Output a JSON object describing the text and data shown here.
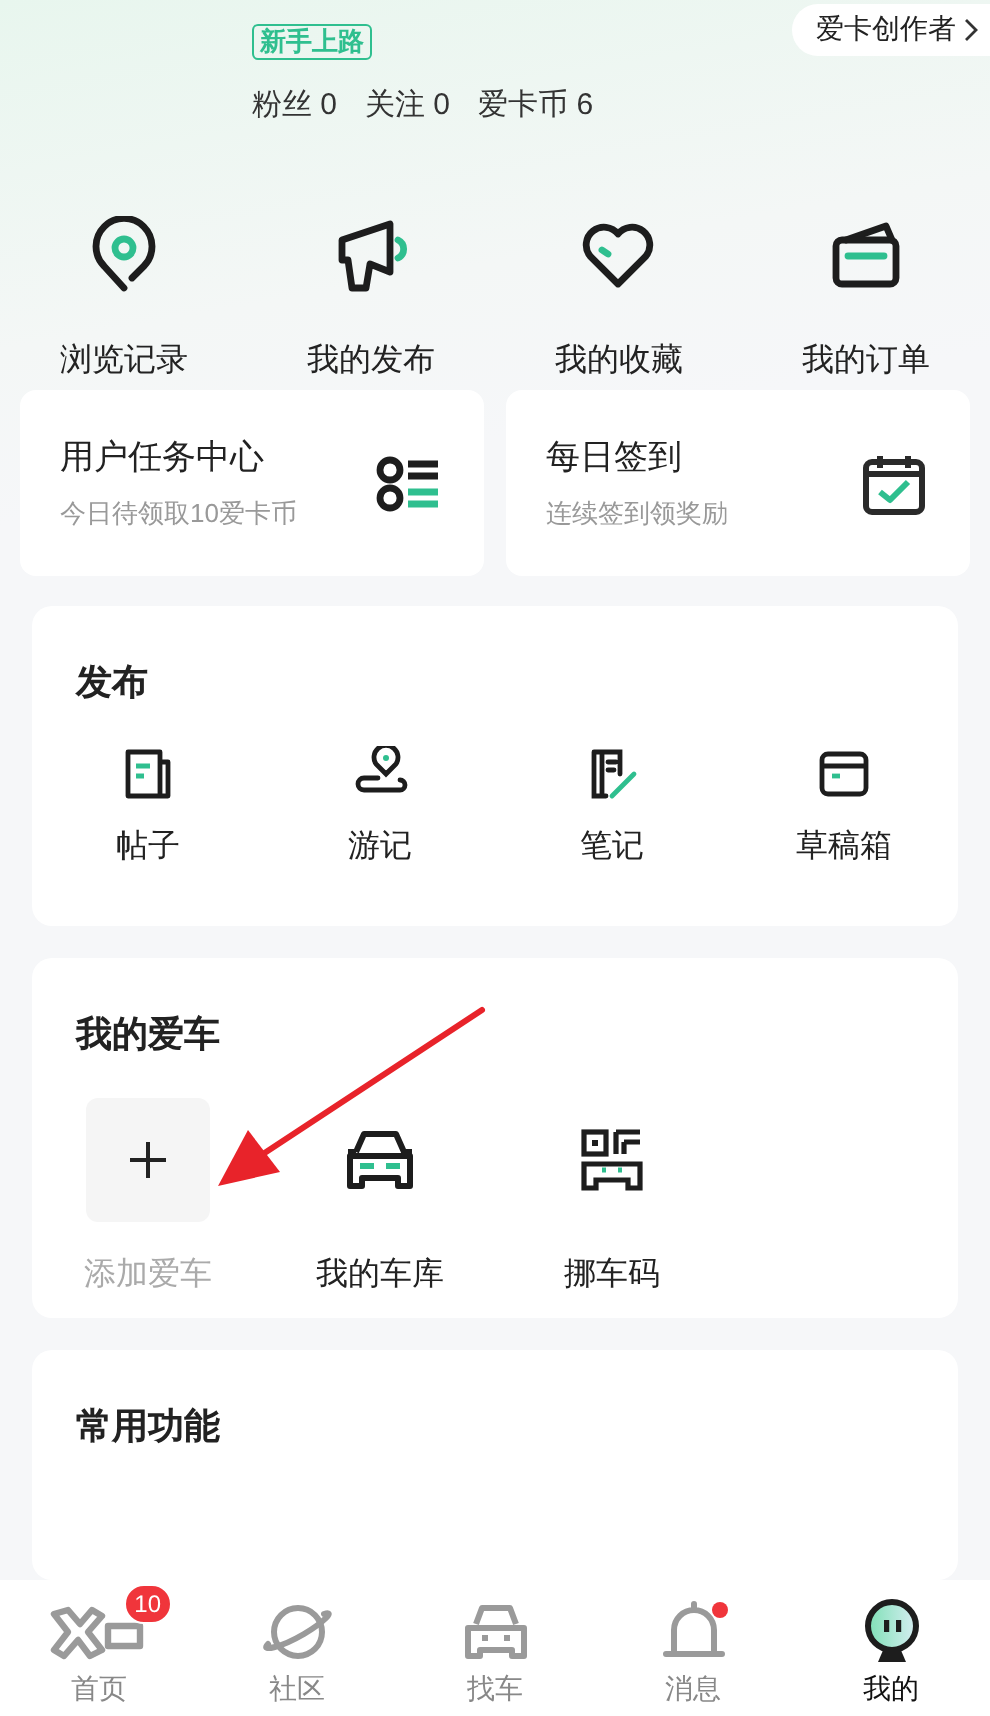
{
  "profile": {
    "badge": "新手上路",
    "stats": [
      "粉丝 0",
      "关注 0",
      "爱卡币 6"
    ],
    "creator_link": "爱卡创作者"
  },
  "quick_links": [
    "浏览记录",
    "我的发布",
    "我的收藏",
    "我的订单"
  ],
  "task_cards": [
    {
      "title": "用户任务中心",
      "subtitle": "今日待领取10爱卡币"
    },
    {
      "title": "每日签到",
      "subtitle": "连续签到领奖励"
    }
  ],
  "publish": {
    "title": "发布",
    "items": [
      "帖子",
      "游记",
      "笔记",
      "草稿箱"
    ]
  },
  "my_car": {
    "title": "我的爱车",
    "items": [
      {
        "label": "添加爱车",
        "kind": "add"
      },
      {
        "label": "我的车库",
        "kind": "icon"
      },
      {
        "label": "挪车码",
        "kind": "icon"
      }
    ]
  },
  "common": {
    "title": "常用功能"
  },
  "tab_bar": [
    {
      "label": "首页",
      "selected": false,
      "badge": "10",
      "dot": false
    },
    {
      "label": "社区",
      "selected": false,
      "dot": false
    },
    {
      "label": "找车",
      "selected": false,
      "dot": false
    },
    {
      "label": "消息",
      "selected": false,
      "dot": true
    },
    {
      "label": "我的",
      "selected": true,
      "dot": false
    }
  ]
}
